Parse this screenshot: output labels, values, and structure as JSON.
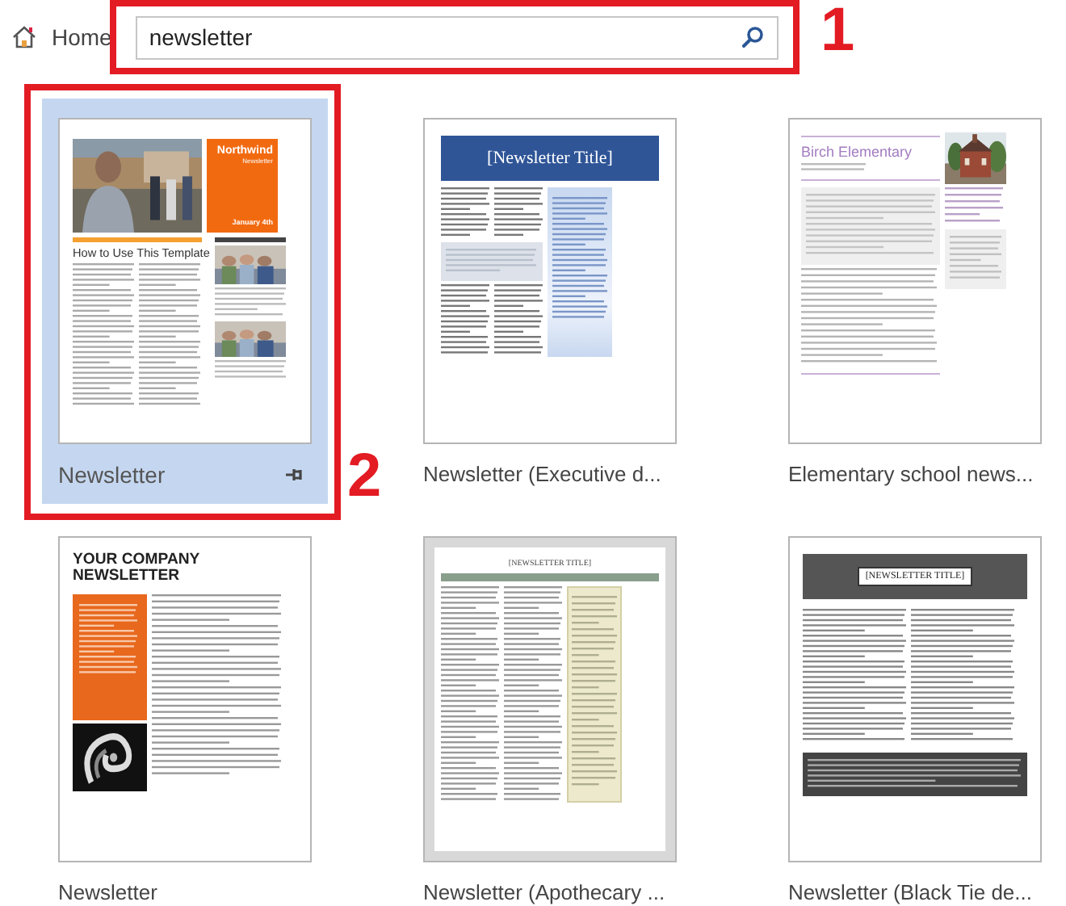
{
  "header": {
    "home": "Home",
    "search": {
      "value": "newsletter"
    }
  },
  "annotations": [
    {
      "label": "1"
    },
    {
      "label": "2"
    }
  ],
  "templates": [
    {
      "title": "Newsletter",
      "selected": true,
      "preview": {
        "kind": "northwind",
        "texts": [
          "Northwind",
          "Newsletter",
          "January 4th",
          "How to Use This Template"
        ]
      }
    },
    {
      "title": "Newsletter (Executive d...",
      "selected": false,
      "preview": {
        "kind": "executive",
        "texts": [
          "[Newsletter Title]"
        ]
      }
    },
    {
      "title": "Elementary school news...",
      "selected": false,
      "preview": {
        "kind": "elementary",
        "texts": [
          "Birch Elementary"
        ]
      }
    },
    {
      "title": "Newsletter",
      "selected": false,
      "preview": {
        "kind": "company",
        "texts": [
          "YOUR COMPANY NEWSLETTER"
        ]
      }
    },
    {
      "title": "Newsletter (Apothecary ...",
      "selected": false,
      "preview": {
        "kind": "apothecary",
        "texts": [
          "[NEWSLETTER TITLE]"
        ]
      }
    },
    {
      "title": "Newsletter (Black Tie de...",
      "selected": false,
      "preview": {
        "kind": "blacktie",
        "texts": [
          "[NEWSLETTER TITLE]"
        ]
      }
    }
  ]
}
